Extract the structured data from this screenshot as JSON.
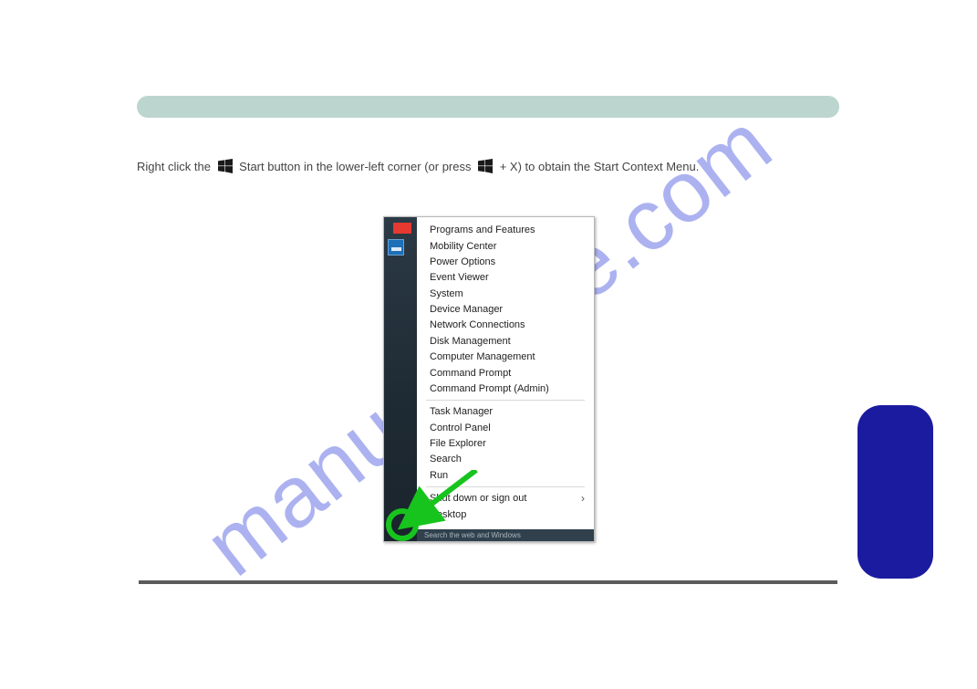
{
  "watermark": "manualshive.com",
  "instruction": {
    "pre": "Right click the ",
    "mid": " Start button in the lower-left corner (or press ",
    "shortcut_key": " + X)",
    "post": " to obtain the Start Context Menu."
  },
  "menu": {
    "group1": [
      "Programs and Features",
      "Mobility Center",
      "Power Options",
      "Event Viewer",
      "System",
      "Device Manager",
      "Network Connections",
      "Disk Management",
      "Computer Management",
      "Command Prompt",
      "Command Prompt (Admin)"
    ],
    "group2": [
      "Task Manager",
      "Control Panel",
      "File Explorer",
      "Search",
      "Run"
    ],
    "group3": [
      {
        "label": "Shut down or sign out",
        "submenu": true
      },
      {
        "label": "Desktop",
        "submenu": false
      }
    ]
  },
  "search_placeholder": "Search the web and Windows"
}
